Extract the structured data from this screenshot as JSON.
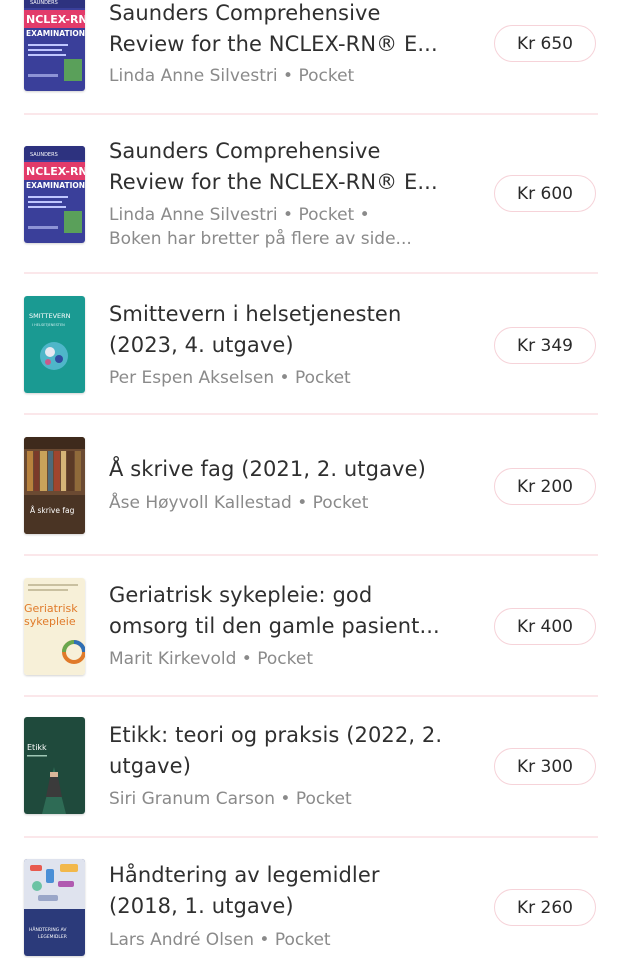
{
  "listings": [
    {
      "title_lines": [
        "Saunders Comprehensive",
        "Review for the NCLEX-RN® E..."
      ],
      "meta_lines": [
        "Linda Anne Silvestri • Pocket"
      ],
      "price": "Kr 650",
      "cover": {
        "top_text": "SAUNDERS",
        "main_text": "NCLEX-RN",
        "sub_text": "EXAMINATION",
        "bg": "#3a3f9a",
        "accent": "#e23b6a"
      }
    },
    {
      "title_lines": [
        "Saunders Comprehensive",
        "Review for the NCLEX-RN® E..."
      ],
      "meta_lines": [
        "Linda Anne Silvestri • Pocket •",
        "Boken har bretter på flere av side..."
      ],
      "price": "Kr 600",
      "cover": {
        "top_text": "SAUNDERS",
        "main_text": "NCLEX-RN",
        "sub_text": "EXAMINATION",
        "bg": "#3a3f9a",
        "accent": "#e23b6a"
      }
    },
    {
      "title_lines": [
        "Smittevern i helsetjenesten",
        "(2023, 4. utgave)"
      ],
      "meta_lines": [
        "Per Espen Akselsen • Pocket"
      ],
      "price": "Kr 349",
      "cover": {
        "main_text": "SMITTEVERN",
        "sub_text": "I HELSETJENESTEN",
        "bg": "#1a9a92"
      }
    },
    {
      "title_lines": [
        "Å skrive fag (2021, 2. utgave)"
      ],
      "meta_lines": [
        "Åse Høyvoll Kallestad • Pocket"
      ],
      "price": "Kr 200",
      "cover": {
        "main_text": "Å skrive fag",
        "bg": "#6b4a32"
      }
    },
    {
      "title_lines": [
        "Geriatrisk sykepleie: god",
        "omsorg til den gamle pasient..."
      ],
      "meta_lines": [
        "Marit Kirkevold • Pocket"
      ],
      "price": "Kr 400",
      "cover": {
        "main_text": "Geriatrisk",
        "sub_text": "sykepleie",
        "bg": "#f7f0d8",
        "accent": "#e07a2a"
      }
    },
    {
      "title_lines": [
        "Etikk: teori og praksis (2022, 2.",
        "utgave)"
      ],
      "meta_lines": [
        "Siri Granum Carson • Pocket"
      ],
      "price": "Kr 300",
      "cover": {
        "main_text": "Etikk",
        "bg": "#1f4a3c"
      }
    },
    {
      "title_lines": [
        "Håndtering av legemidler",
        "(2018, 1. utgave)"
      ],
      "meta_lines": [
        "Lars André Olsen • Pocket"
      ],
      "price": "Kr 260",
      "cover": {
        "main_text": "HÅNDTERING AV",
        "sub_text": "LEGEMIDLER",
        "bg": "#2b3a7a"
      }
    }
  ]
}
